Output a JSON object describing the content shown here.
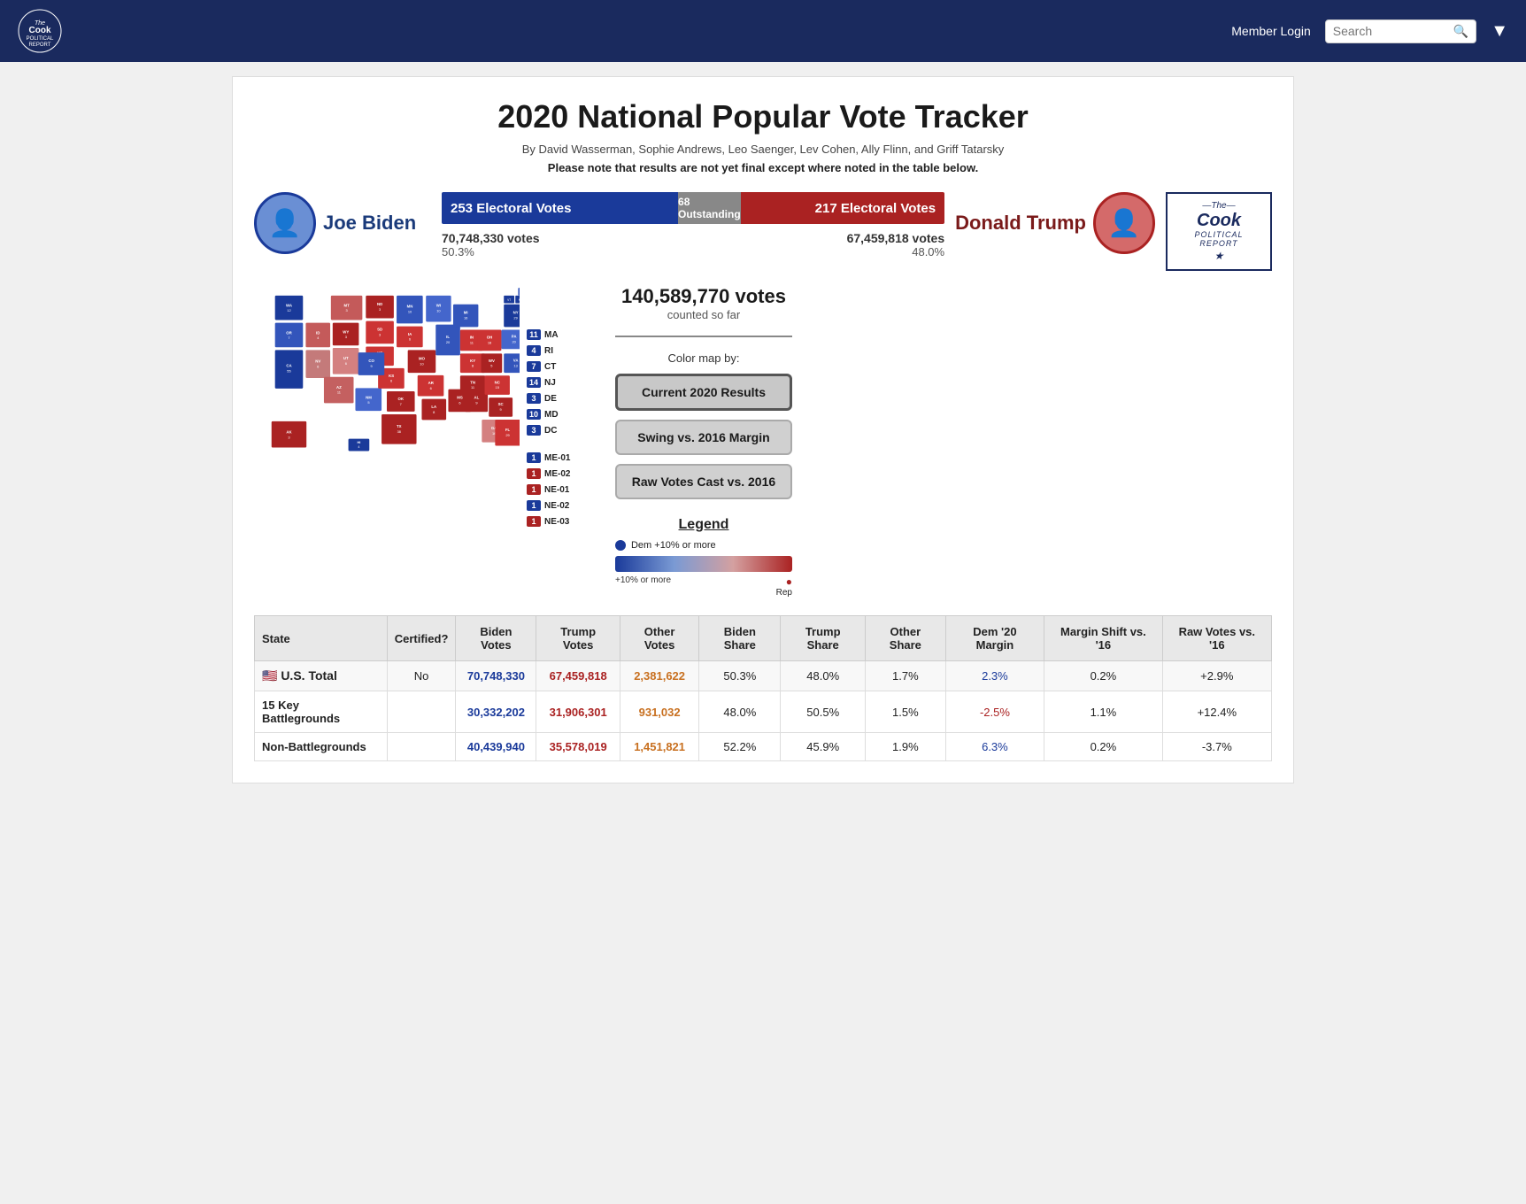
{
  "header": {
    "logo_line1": "The",
    "logo_line2": "Cook",
    "logo_line3": "Political",
    "logo_line4": "Report",
    "member_login": "Member Login",
    "search_placeholder": "Search",
    "dropdown_label": "▼"
  },
  "page": {
    "title": "2020 National Popular Vote Tracker",
    "authors": "By David Wasserman, Sophie Andrews, Leo Saenger, Lev Cohen, Ally Flinn, and Griff Tatarsky",
    "disclaimer": "Please note that results are not yet final except where noted in the table below."
  },
  "biden": {
    "name": "Joe Biden",
    "electoral_votes": "253 Electoral Votes",
    "total_votes": "70,748,330 votes",
    "pct": "50.3%"
  },
  "trump": {
    "name": "Donald Trump",
    "electoral_votes": "217 Electoral Votes",
    "total_votes": "67,459,818 votes",
    "pct": "48.0%"
  },
  "outstanding": {
    "label": "68 Outstanding"
  },
  "sidebar": {
    "votes_counted": "140,589,770 votes",
    "votes_counted_sub": "counted so far",
    "color_map_label": "Color map by:",
    "button1": "Current 2020 Results",
    "button2": "Swing vs. 2016 Margin",
    "button3": "Raw Votes Cast vs. 2016",
    "legend_title": "Legend",
    "legend_dem": "Dem +10% or more",
    "legend_rep_label": "+10% or more",
    "legend_rep_sub": "Rep"
  },
  "cook_logo": {
    "line1": "—The—",
    "line2": "Cook",
    "line3": "POLITICAL",
    "line4": "REPORT",
    "star": "★"
  },
  "small_states": [
    {
      "num": "11",
      "name": "MA",
      "party": "dem"
    },
    {
      "num": "4",
      "name": "RI",
      "party": "dem"
    },
    {
      "num": "7",
      "name": "CT",
      "party": "dem"
    },
    {
      "num": "14",
      "name": "NJ",
      "party": "dem"
    },
    {
      "num": "3",
      "name": "DE",
      "party": "dem"
    },
    {
      "num": "10",
      "name": "MD",
      "party": "dem"
    },
    {
      "num": "3",
      "name": "DC",
      "party": "dem"
    },
    {
      "num": "1",
      "name": "ME-01",
      "party": "dem"
    },
    {
      "num": "1",
      "name": "ME-02",
      "party": "rep"
    },
    {
      "num": "1",
      "name": "NE-01",
      "party": "rep"
    },
    {
      "num": "1",
      "name": "NE-02",
      "party": "dem"
    },
    {
      "num": "1",
      "name": "NE-03",
      "party": "rep"
    }
  ],
  "table": {
    "headers": [
      "State",
      "Certified?",
      "Biden Votes",
      "Trump Votes",
      "Other Votes",
      "Biden Share",
      "Trump Share",
      "Other Share",
      "Dem '20 Margin",
      "Margin Shift vs. '16",
      "Raw Votes vs. '16"
    ],
    "rows": [
      {
        "state": "🇺🇸 U.S. Total",
        "certified": "No",
        "biden_votes": "70,748,330",
        "trump_votes": "67,459,818",
        "other_votes": "2,381,622",
        "biden_share": "50.3%",
        "trump_share": "48.0%",
        "other_share": "1.7%",
        "dem_margin": "2.3%",
        "margin_shift": "0.2%",
        "raw_votes": "+2.9%",
        "is_total": true
      },
      {
        "state": "15 Key Battlegrounds",
        "certified": "",
        "biden_votes": "30,332,202",
        "trump_votes": "31,906,301",
        "other_votes": "931,032",
        "biden_share": "48.0%",
        "trump_share": "50.5%",
        "other_share": "1.5%",
        "dem_margin": "-2.5%",
        "margin_shift": "1.1%",
        "raw_votes": "+12.4%",
        "is_total": false
      },
      {
        "state": "Non-Battlegrounds",
        "certified": "",
        "biden_votes": "40,439,940",
        "trump_votes": "35,578,019",
        "other_votes": "1,451,821",
        "biden_share": "52.2%",
        "trump_share": "45.9%",
        "other_share": "1.9%",
        "dem_margin": "6.3%",
        "margin_shift": "0.2%",
        "raw_votes": "-3.7%",
        "is_total": false
      }
    ]
  },
  "colors": {
    "dem_dark": "#1a3a9a",
    "dem_light": "#7a9ad4",
    "rep_dark": "#aa2222",
    "rep_light": "#d46a6a",
    "neutral": "#888888",
    "header_bg": "#1a2a5e"
  }
}
